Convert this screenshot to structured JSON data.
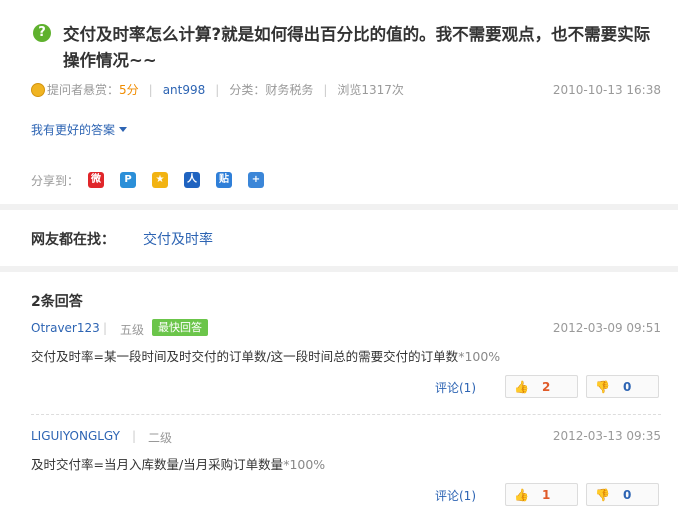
{
  "question": {
    "badge": "?",
    "title": "交付及时率怎么计算?就是如何得出百分比的值的。我不需要观点，也不需要实际操作情况~~",
    "reward_label": "提问者悬赏：",
    "reward_value": "5分",
    "asker": "ant998",
    "category": "分类：财务税务",
    "views": "浏览1317次",
    "date": "2010-10-13 16:38",
    "better_answer": "我有更好的答案"
  },
  "share": {
    "label": "分享到：",
    "icons": [
      {
        "name": "weibo-icon",
        "glyph": "微",
        "color": "#e0262a"
      },
      {
        "name": "qzone-icon",
        "glyph": "P",
        "color": "#2b8fd8"
      },
      {
        "name": "qq-space-icon",
        "glyph": "★",
        "color": "#f2b312"
      },
      {
        "name": "renren-icon",
        "glyph": "人",
        "color": "#1f63c0"
      },
      {
        "name": "tieba-icon",
        "glyph": "贴",
        "color": "#2f7fd8"
      },
      {
        "name": "more-share-icon",
        "glyph": "+",
        "color": "#3b86d8"
      }
    ]
  },
  "find": {
    "label": "网友都在找：",
    "link": "交付及时率"
  },
  "answers": {
    "count": "2条回答",
    "items": [
      {
        "user": "Otraver123",
        "level": "五级",
        "tag": "最快回答",
        "date": "2012-03-09 09:51",
        "text": "交付及时率=某一段时间及时交付的订单数/这一段时间总的需要交付的订单数",
        "suffix": "*100%",
        "comment": "评论(1)",
        "up": "2",
        "down": "0"
      },
      {
        "user": "LIGUIYONGLGY",
        "level": "二级",
        "tag": "",
        "date": "2012-03-13 09:35",
        "text": "及时交付率=当月入库数量/当月采购订单数量",
        "suffix": "*100%",
        "comment": "评论(1)",
        "up": "1",
        "down": "0"
      }
    ]
  },
  "colors": {
    "link": "#2d64b3",
    "accent_green": "#6bc54a",
    "reward_orange": "#f08c00",
    "upvote_red": "#e05a28"
  }
}
